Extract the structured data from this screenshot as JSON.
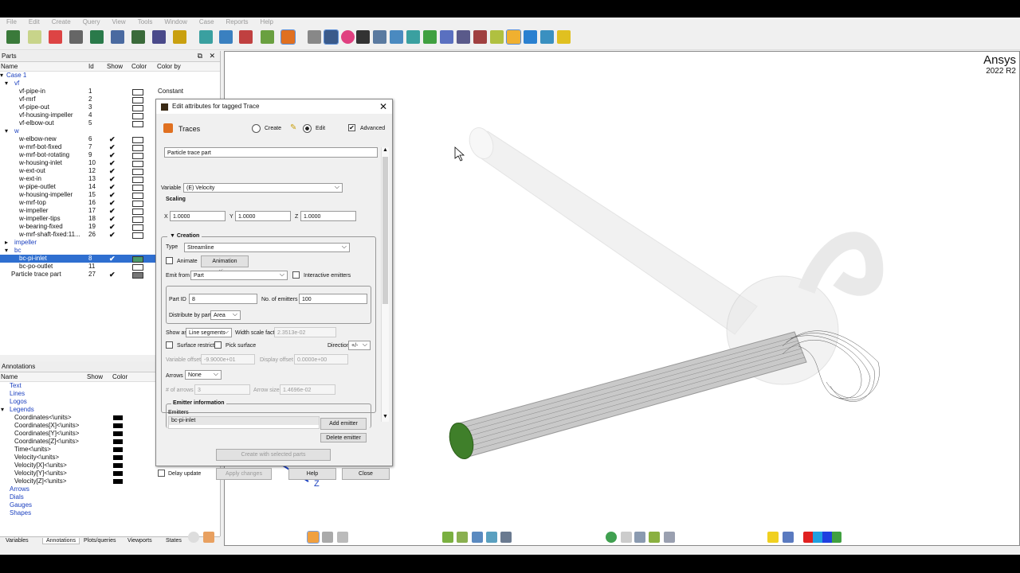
{
  "menu": [
    "File",
    "Edit",
    "Create",
    "Query",
    "View",
    "Tools",
    "Window",
    "Case",
    "Reports",
    "Help"
  ],
  "parts_panel": {
    "title": "Parts",
    "columns": {
      "name": "Name",
      "id": "Id",
      "show": "Show",
      "color": "Color",
      "colorby": "Color by"
    },
    "rows": [
      {
        "name": "Case 1",
        "indent": 0,
        "blue": true
      },
      {
        "name": "vf",
        "indent": 1,
        "blue": true
      },
      {
        "name": "vf-pipe-in",
        "id": "1",
        "indent": 2,
        "colorby": "Constant"
      },
      {
        "name": "vf-mrf",
        "id": "2",
        "indent": 2
      },
      {
        "name": "vf-pipe-out",
        "id": "3",
        "indent": 2
      },
      {
        "name": "vf-housing-impeller",
        "id": "4",
        "indent": 2
      },
      {
        "name": "vf-elbow-out",
        "id": "5",
        "indent": 2
      },
      {
        "name": "w",
        "indent": 1,
        "blue": true
      },
      {
        "name": "w-elbow-new",
        "id": "6",
        "indent": 2,
        "show": "✔"
      },
      {
        "name": "w-mrf-bot-fixed",
        "id": "7",
        "indent": 2,
        "show": "✔"
      },
      {
        "name": "w-mrf-bot-rotating",
        "id": "9",
        "indent": 2,
        "show": "✔"
      },
      {
        "name": "w-housing-inlet",
        "id": "10",
        "indent": 2,
        "show": "✔"
      },
      {
        "name": "w-ext-out",
        "id": "12",
        "indent": 2,
        "show": "✔"
      },
      {
        "name": "w-ext-in",
        "id": "13",
        "indent": 2,
        "show": "✔"
      },
      {
        "name": "w-pipe-outlet",
        "id": "14",
        "indent": 2,
        "show": "✔"
      },
      {
        "name": "w-housing-impeller",
        "id": "15",
        "indent": 2,
        "show": "✔"
      },
      {
        "name": "w-mrf-top",
        "id": "16",
        "indent": 2,
        "show": "✔"
      },
      {
        "name": "w-impeller",
        "id": "17",
        "indent": 2,
        "show": "✔"
      },
      {
        "name": "w-impeller-tips",
        "id": "18",
        "indent": 2,
        "show": "✔"
      },
      {
        "name": "w-bearing-fixed",
        "id": "19",
        "indent": 2,
        "show": "✔"
      },
      {
        "name": "w-mrf-shaft-fixed:11...",
        "id": "26",
        "indent": 2,
        "show": "✔"
      },
      {
        "name": "impeller",
        "indent": 1,
        "blue": true
      },
      {
        "name": "bc",
        "indent": 1,
        "blue": true
      },
      {
        "name": "bc-pi-inlet",
        "id": "8",
        "indent": 2,
        "show": "✔",
        "selected": true,
        "color": "green"
      },
      {
        "name": "bc-po-outlet",
        "id": "11",
        "indent": 2
      },
      {
        "name": "Particle trace part",
        "id": "27",
        "indent": 1,
        "show": "✔",
        "color": "dark"
      }
    ]
  },
  "annotations_panel": {
    "title": "Annotations",
    "columns": {
      "name": "Name",
      "show": "Show",
      "color": "Color"
    },
    "rows": [
      {
        "name": "Text",
        "indent": 1,
        "blue": true
      },
      {
        "name": "Lines",
        "indent": 1,
        "blue": true
      },
      {
        "name": "Logos",
        "indent": 1,
        "blue": true
      },
      {
        "name": "Legends",
        "indent": 1,
        "blue": true
      },
      {
        "name": "Coordinates<\\units>",
        "indent": 2,
        "swatch": true
      },
      {
        "name": "Coordinates[X]<\\units>",
        "indent": 2,
        "swatch": true
      },
      {
        "name": "Coordinates[Y]<\\units>",
        "indent": 2,
        "swatch": true
      },
      {
        "name": "Coordinates[Z]<\\units>",
        "indent": 2,
        "swatch": true
      },
      {
        "name": "Time<\\units>",
        "indent": 2,
        "swatch": true
      },
      {
        "name": "Velocity<\\units>",
        "indent": 2,
        "swatch": true
      },
      {
        "name": "Velocity[X]<\\units>",
        "indent": 2,
        "swatch": true
      },
      {
        "name": "Velocity[Y]<\\units>",
        "indent": 2,
        "swatch": true
      },
      {
        "name": "Velocity[Z]<\\units>",
        "indent": 2,
        "swatch": true
      },
      {
        "name": "Arrows",
        "indent": 1,
        "blue": true
      },
      {
        "name": "Dials",
        "indent": 1,
        "blue": true
      },
      {
        "name": "Gauges",
        "indent": 1,
        "blue": true
      },
      {
        "name": "Shapes",
        "indent": 1,
        "blue": true
      }
    ]
  },
  "bottom_tabs": [
    "Variables",
    "Annotations",
    "Plots/queries",
    "Viewports",
    "States"
  ],
  "viewport": {
    "brand": "Ansys",
    "version": "2022 R2",
    "axis_label": "Z"
  },
  "dialog": {
    "title": "Edit attributes for tagged Trace",
    "traces_label": "Traces",
    "create_label": "Create",
    "edit_label": "Edit",
    "advanced_label": "Advanced",
    "name_value": "Particle trace part",
    "variable_label": "Variable",
    "variable_value": "(E) Velocity",
    "scaling_label": "Scaling",
    "x_label": "X",
    "x_value": "1.0000",
    "y_label": "Y",
    "y_value": "1.0000",
    "z_label": "Z",
    "z_value": "1.0000",
    "creation_label": "Creation",
    "type_label": "Type",
    "type_value": "Streamline",
    "animate_label": "Animate",
    "animation_settings": "Animation settings...",
    "emit_from_label": "Emit from",
    "emit_from_value": "Part",
    "interactive_emitters": "Interactive emitters",
    "part_id_label": "Part ID",
    "part_id_value": "8",
    "num_emitters_label": "No. of emitters",
    "num_emitters_value": "100",
    "distribute_label": "Distribute by part",
    "distribute_value": "Area",
    "show_as_label": "Show as",
    "show_as_value": "Line segments",
    "width_scale_label": "Width scale factor",
    "width_scale_value": "2.3513e-02",
    "surface_restrict": "Surface restrict",
    "pick_surface": "Pick surface",
    "direction_label": "Direction",
    "direction_value": "+/-",
    "variable_offset_label": "Variable offset",
    "variable_offset_value": "-9.9000e+01",
    "display_offset_label": "Display offset",
    "display_offset_value": "0.0000e+00",
    "arrows_label": "Arrows",
    "arrows_value": "None",
    "num_arrows_label": "# of arrows",
    "num_arrows_value": "3",
    "arrow_size_label": "Arrow size",
    "arrow_size_value": "1.4696e-02",
    "emitter_info_label": "Emitter information",
    "emitters_label": "Emitters",
    "emitter_item": "bc-pi-inlet",
    "add_emitter": "Add emitter",
    "delete_emitter": "Delete emitter",
    "create_with_selected": "Create with selected parts",
    "delay_update": "Delay update",
    "apply_changes": "Apply changes",
    "help": "Help",
    "close": "Close"
  }
}
